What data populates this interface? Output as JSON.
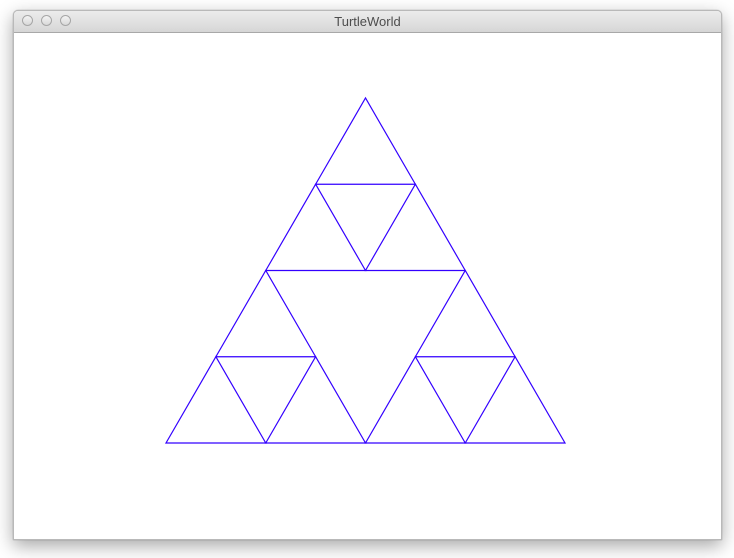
{
  "window": {
    "title": "TurtleWorld"
  },
  "titlebar_buttons": [
    {
      "name": "close"
    },
    {
      "name": "minimize"
    },
    {
      "name": "zoom"
    }
  ],
  "drawing": {
    "stroke_color": "#3300ff",
    "shape": "sierpinski-triangle",
    "depth": 2
  }
}
